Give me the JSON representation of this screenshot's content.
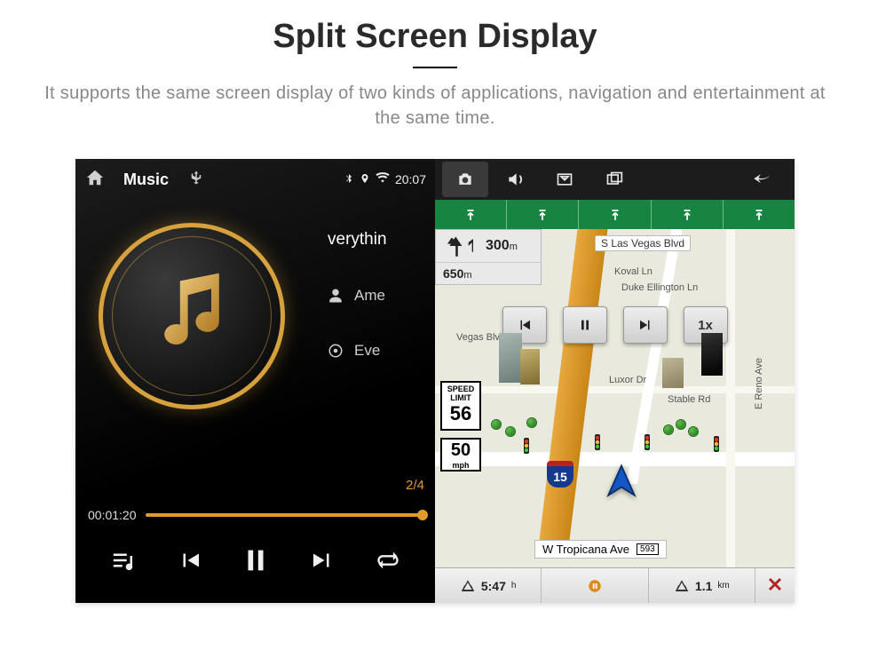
{
  "header": {
    "title": "Split Screen Display",
    "subtitle": "It supports the same screen display of two kinds of applications, navigation and entertainment at the same time."
  },
  "music": {
    "top": {
      "section": "Music",
      "source": "USB",
      "clock": "20:07"
    },
    "tracks": {
      "now": "verythin",
      "artist": "Ame",
      "next": "Eve"
    },
    "counter": "2/4",
    "elapsed": "00:01:20"
  },
  "sysbar": {
    "camera": "camera",
    "volume": "volume",
    "screenshot": "screenshot",
    "windows": "windows",
    "back": "back"
  },
  "map": {
    "lanes_count": 5,
    "turn": {
      "dist": "300",
      "dist_unit": "m",
      "remaining": "650",
      "remaining_unit": "m"
    },
    "streets": {
      "slasvegas": "S Las Vegas Blvd",
      "koval": "Koval Ln",
      "duke": "Duke Ellington Ln",
      "vegas2": "Vegas Blvd",
      "luxor": "Luxor Dr",
      "stable": "Stable Rd",
      "reno": "E Reno Ave",
      "tropicana": "W Tropicana Ave",
      "trop_route": "593",
      "hwy_route": "15"
    },
    "speed_limit": {
      "label1": "SPEED",
      "label2": "LIMIT",
      "value": "56"
    },
    "mph": {
      "value": "50",
      "unit": "mph"
    },
    "interstate": "15",
    "float_speed": "1x",
    "bottom": {
      "eta": "5:47",
      "eta_unit": "h",
      "pause": "||",
      "dist": "1.1",
      "dist_unit": "km"
    }
  }
}
